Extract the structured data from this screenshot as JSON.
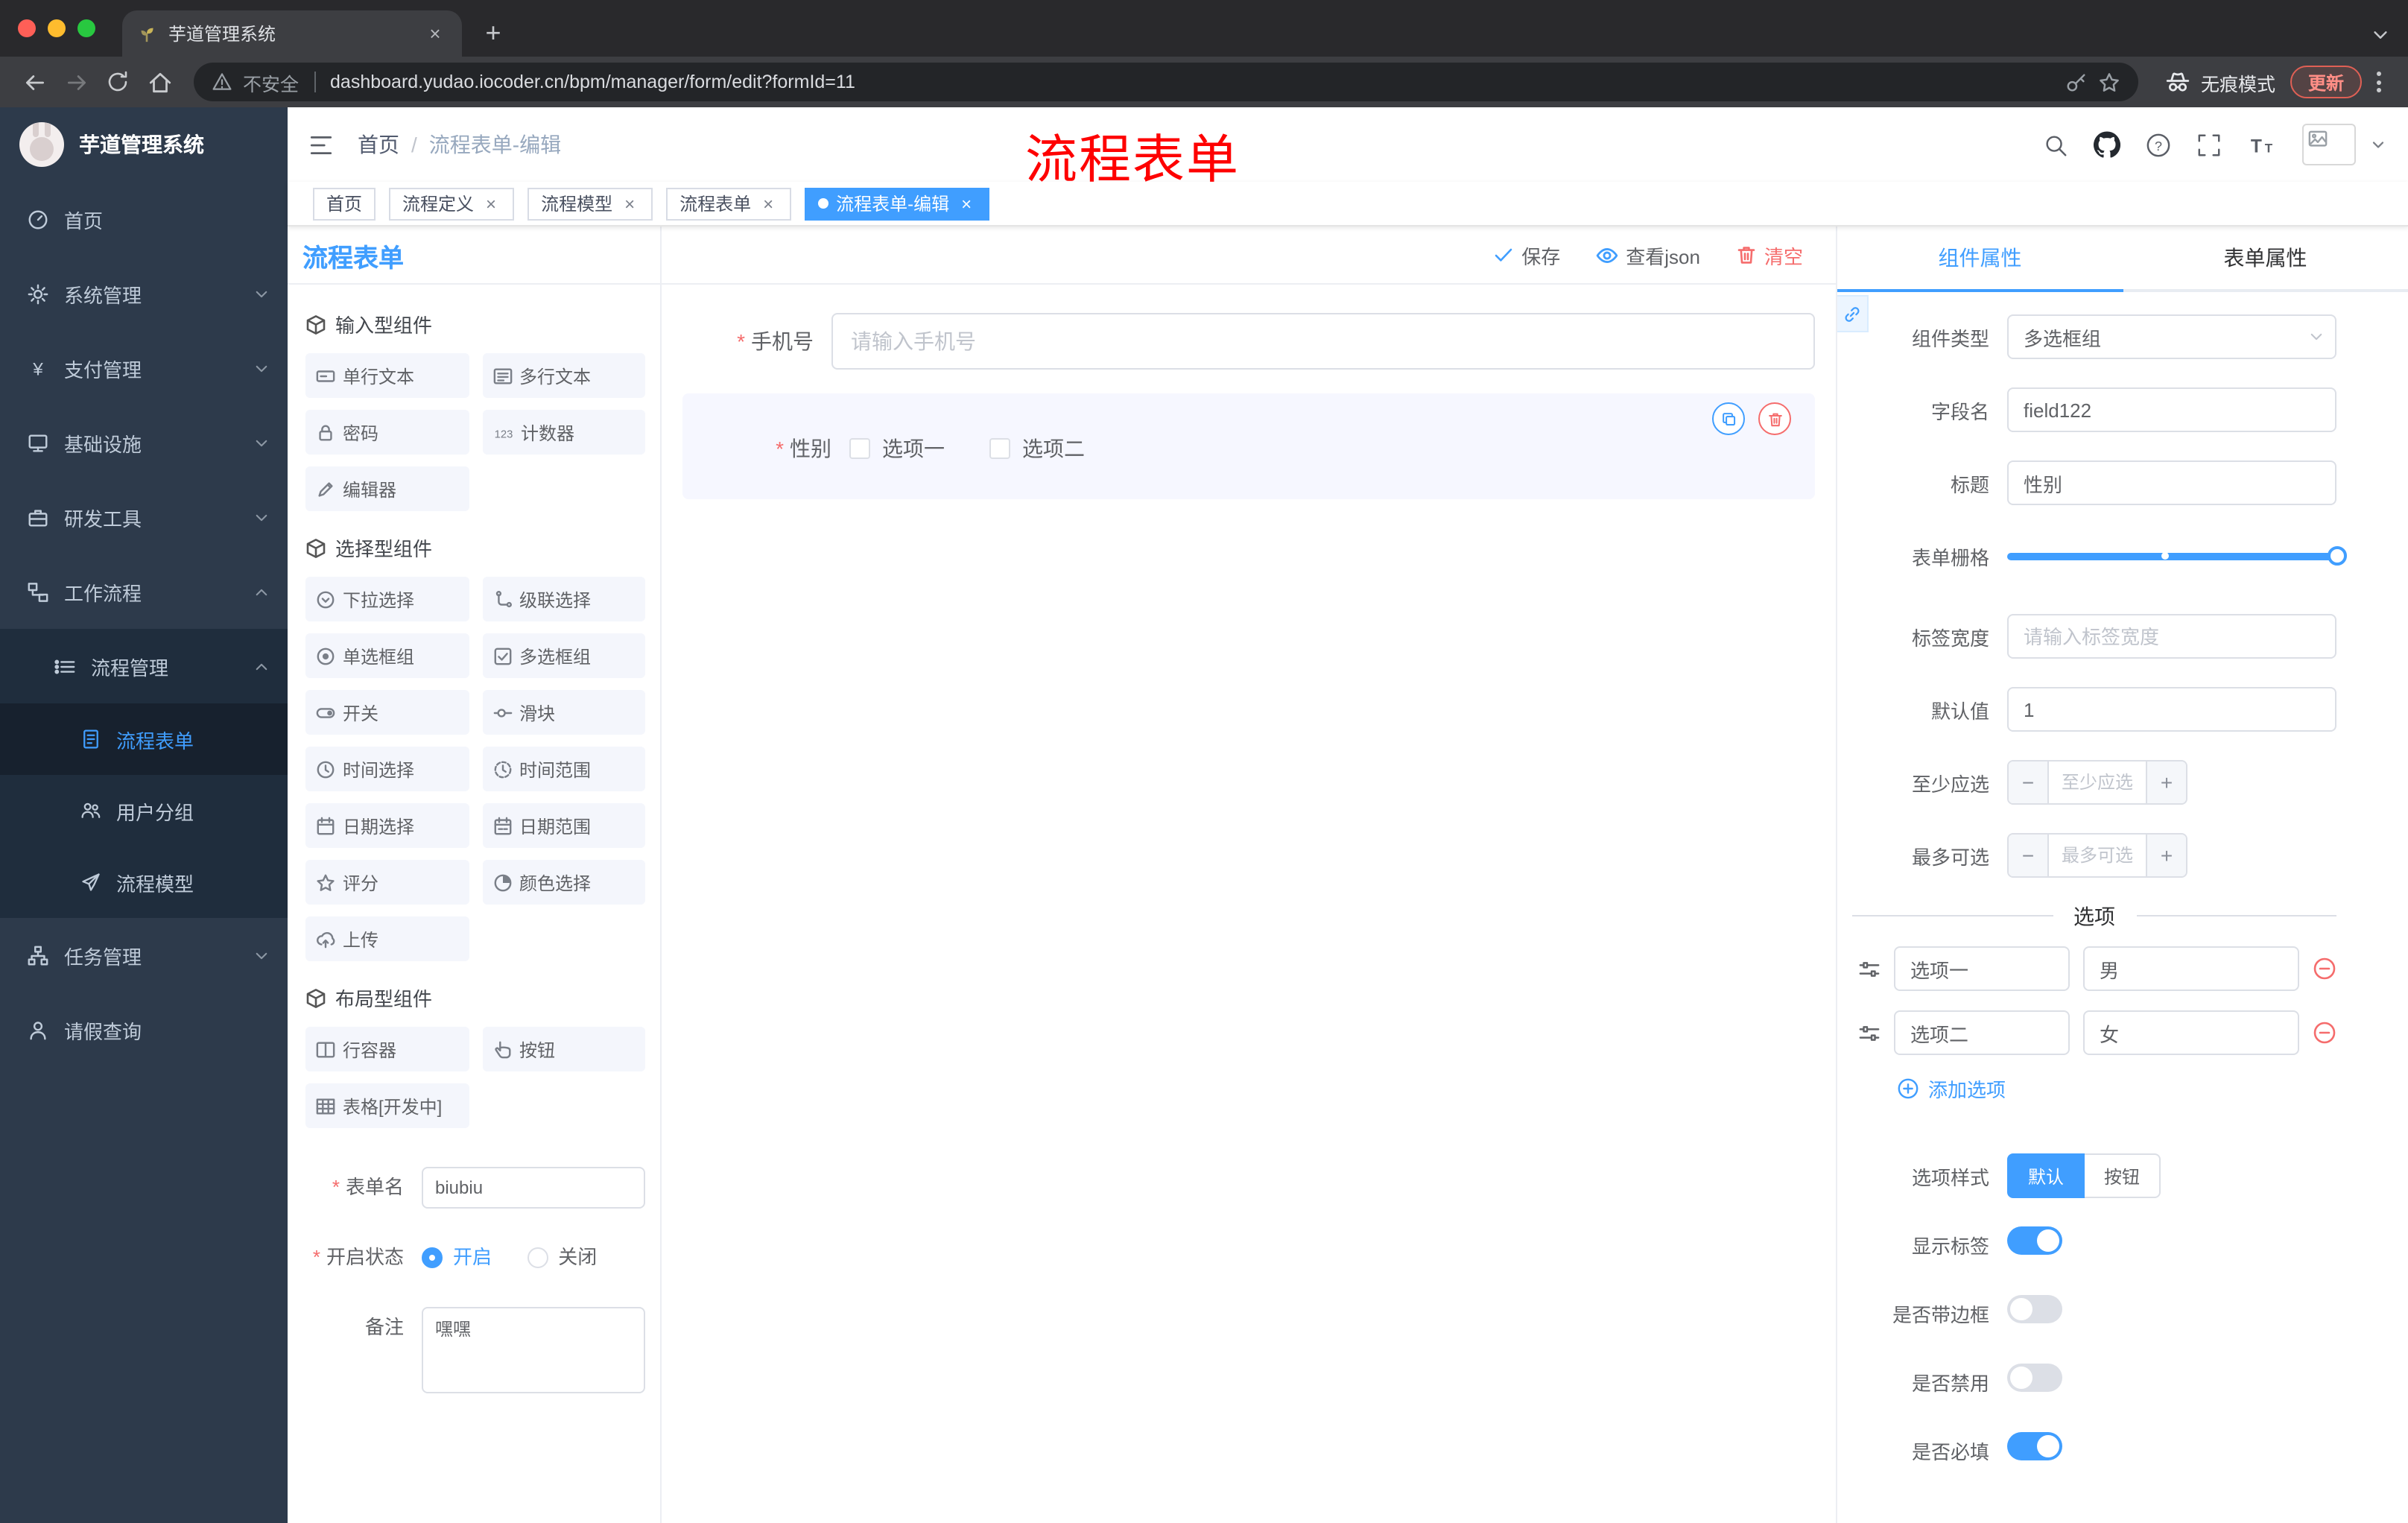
{
  "colors": {
    "accent": "#409EFF",
    "danger": "#F56C6C",
    "annotation": "#FE0000",
    "sidebar_bg": "#2D3A4B"
  },
  "icons": {
    "close": "×",
    "plus": "+",
    "minus": "−",
    "help": "?",
    "yen": "¥",
    "counter": "123",
    "font_big": "T",
    "font_small": "T"
  },
  "browser": {
    "tab_title": "芋道管理系统",
    "security_label": "不安全",
    "url": "dashboard.yudao.iocoder.cn/bpm/manager/form/edit?formId=11",
    "incognito_label": "无痕模式",
    "update_label": "更新"
  },
  "sidebar": {
    "brand": "芋道管理系统",
    "items": [
      {
        "label": "首页"
      },
      {
        "label": "系统管理"
      },
      {
        "label": "支付管理"
      },
      {
        "label": "基础设施"
      },
      {
        "label": "研发工具"
      },
      {
        "label": "工作流程"
      },
      {
        "label": "流程管理"
      },
      {
        "label": "流程表单"
      },
      {
        "label": "用户分组"
      },
      {
        "label": "流程模型"
      },
      {
        "label": "任务管理"
      },
      {
        "label": "请假查询"
      }
    ]
  },
  "header": {
    "breadcrumb": [
      "首页",
      "流程表单-编辑"
    ],
    "annotation": "流程表单"
  },
  "tags": {
    "items": [
      {
        "label": "首页"
      },
      {
        "label": "流程定义"
      },
      {
        "label": "流程模型"
      },
      {
        "label": "流程表单"
      },
      {
        "label": "流程表单-编辑"
      }
    ]
  },
  "designer": {
    "panel_title": "流程表单",
    "groups": [
      {
        "title": "输入型组件",
        "items": [
          "单行文本",
          "多行文本",
          "密码",
          "计数器",
          "编辑器"
        ]
      },
      {
        "title": "选择型组件",
        "items": [
          "下拉选择",
          "级联选择",
          "单选框组",
          "多选框组",
          "开关",
          "滑块",
          "时间选择",
          "时间范围",
          "日期选择",
          "日期范围",
          "评分",
          "颜色选择",
          "上传"
        ]
      },
      {
        "title": "布局型组件",
        "items": [
          "行容器",
          "按钮",
          "表格[开发中]"
        ]
      }
    ],
    "form": {
      "name_label": "表单名",
      "name_value": "biubiu",
      "status_label": "开启状态",
      "status_on": "开启",
      "status_off": "关闭",
      "remark_label": "备注",
      "remark_value": "嘿嘿"
    }
  },
  "canvas": {
    "save": "保存",
    "view_json": "查看json",
    "clear": "清空",
    "phone": {
      "label": "手机号",
      "placeholder": "请输入手机号"
    },
    "gender": {
      "label": "性别",
      "options": [
        "选项一",
        "选项二"
      ]
    }
  },
  "props": {
    "tabs": [
      "组件属性",
      "表单属性"
    ],
    "component_type": {
      "label": "组件类型",
      "value": "多选框组"
    },
    "field_name": {
      "label": "字段名",
      "value": "field122"
    },
    "title": {
      "label": "标题",
      "value": "性别"
    },
    "grid": {
      "label": "表单栅格"
    },
    "label_width": {
      "label": "标签宽度",
      "placeholder": "请输入标签宽度"
    },
    "default_value": {
      "label": "默认值",
      "value": "1"
    },
    "min_select": {
      "label": "至少应选",
      "placeholder": "至少应选"
    },
    "max_select": {
      "label": "最多可选",
      "placeholder": "最多可选"
    },
    "options_divider": "选项",
    "options": [
      {
        "label": "选项一",
        "value": "男"
      },
      {
        "label": "选项二",
        "value": "女"
      }
    ],
    "add_option": "添加选项",
    "option_style": {
      "label": "选项样式",
      "choices": [
        "默认",
        "按钮"
      ],
      "active": "默认"
    },
    "show_label": {
      "label": "显示标签",
      "on": true
    },
    "with_border": {
      "label": "是否带边框",
      "on": false
    },
    "disabled": {
      "label": "是否禁用",
      "on": false
    },
    "required": {
      "label": "是否必填",
      "on": true
    }
  }
}
